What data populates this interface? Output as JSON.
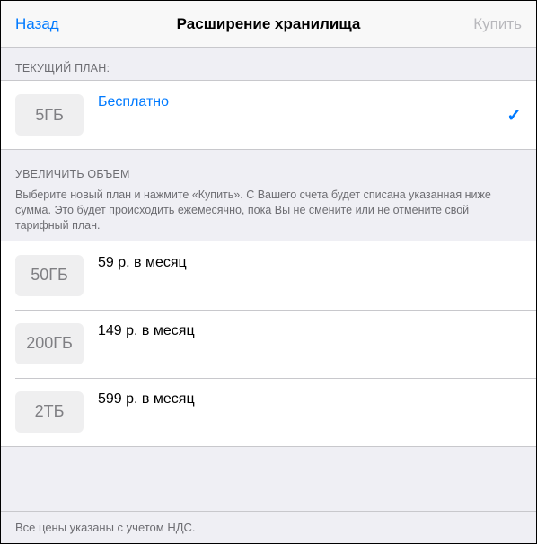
{
  "nav": {
    "back": "Назад",
    "title": "Расширение хранилища",
    "buy": "Купить"
  },
  "current_plan": {
    "header": "ТЕКУЩИЙ ПЛАН:",
    "size": "5ГБ",
    "label": "Бесплатно"
  },
  "upgrade": {
    "header": "УВЕЛИЧИТЬ ОБЪЕМ",
    "desc": "Выберите новый план и нажмите «Купить». С Вашего счета будет списана указанная ниже сумма. Это будет происходить ежемесячно, пока Вы не смените или не отмените свой тарифный план.",
    "plans": [
      {
        "size": "50ГБ",
        "price": "59 р. в месяц"
      },
      {
        "size": "200ГБ",
        "price": "149 р. в месяц"
      },
      {
        "size": "2ТБ",
        "price": "599 р. в месяц"
      }
    ]
  },
  "footer": "Все цены указаны с учетом НДС."
}
